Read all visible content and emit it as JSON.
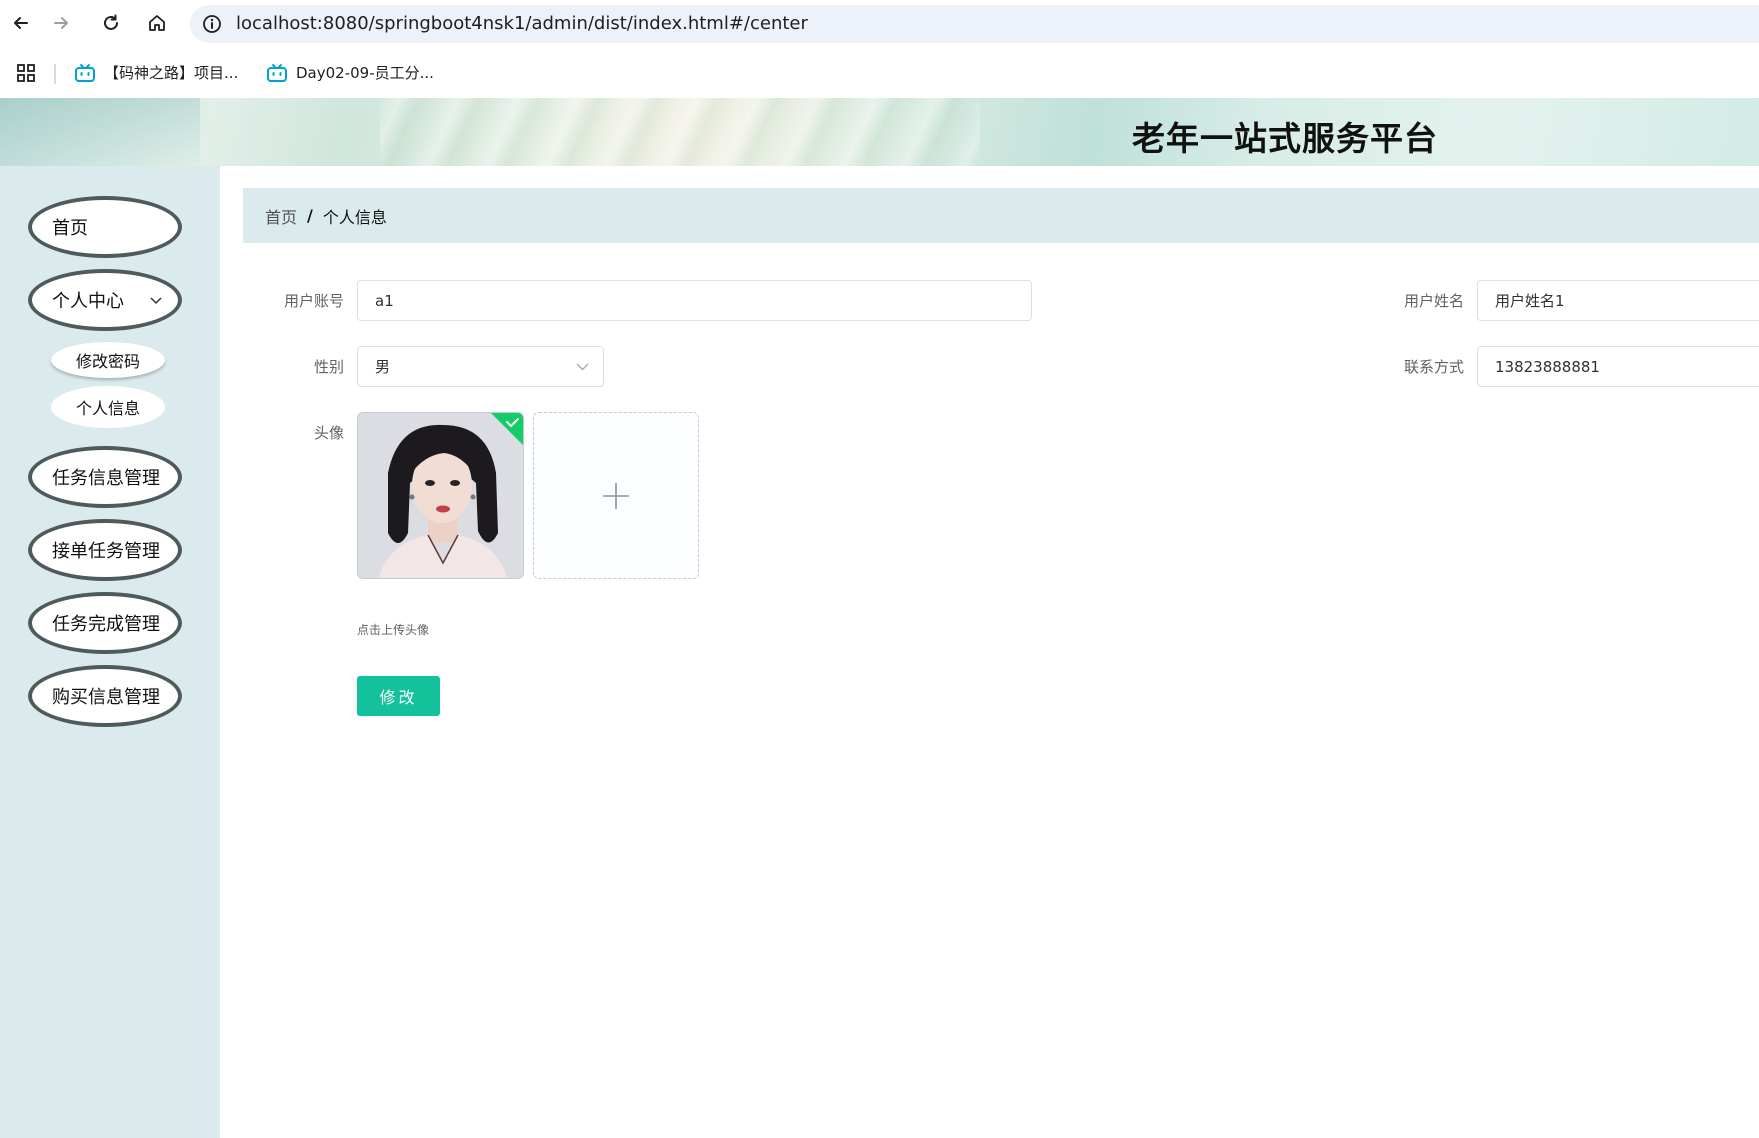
{
  "browser": {
    "url": "localhost:8080/springboot4nsk1/admin/dist/index.html#/center",
    "bookmarks": [
      {
        "label": "【码神之路】项目..."
      },
      {
        "label": "Day02-09-员工分..."
      }
    ]
  },
  "header": {
    "title": "老年一站式服务平台"
  },
  "sidebar": {
    "items": [
      {
        "label": "首页"
      },
      {
        "label": "个人中心",
        "expanded": true,
        "children": [
          {
            "label": "修改密码"
          },
          {
            "label": "个人信息"
          }
        ]
      },
      {
        "label": "任务信息管理"
      },
      {
        "label": "接单任务管理"
      },
      {
        "label": "任务完成管理"
      },
      {
        "label": "购买信息管理"
      }
    ]
  },
  "breadcrumb": {
    "home": "首页",
    "separator": "/",
    "current": "个人信息"
  },
  "form": {
    "account_label": "用户账号",
    "account_value": "a1",
    "name_label": "用户姓名",
    "name_value": "用户姓名1",
    "gender_label": "性别",
    "gender_value": "男",
    "phone_label": "联系方式",
    "phone_value": "13823888881",
    "avatar_label": "头像",
    "upload_tip": "点击上传头像",
    "submit_label": "修改"
  },
  "colors": {
    "sidebar_bg": "#dbebed",
    "primary_button": "#13c29a",
    "success_badge": "#13ce66"
  }
}
